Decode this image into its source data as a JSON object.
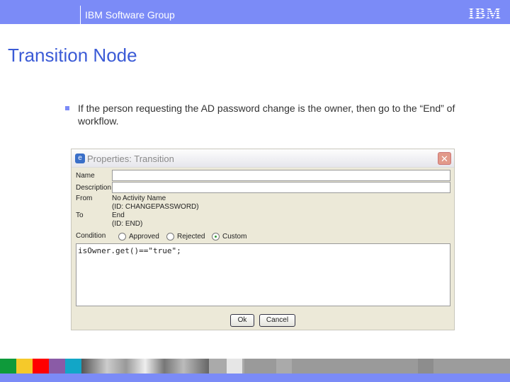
{
  "header": {
    "group": "IBM Software Group",
    "logo": "IBM"
  },
  "slide": {
    "title": "Transition Node",
    "bullet": "If the person requesting the AD password change is the owner, then go to the “End” of workflow."
  },
  "dialog": {
    "title": "Properties: Transition",
    "close": "✕",
    "name_label": "Name",
    "name_value": "",
    "description_label": "Description",
    "description_value": "",
    "from_label": "From",
    "from_line1": "No Activity Name",
    "from_line2": "(ID: CHANGEPASSWORD)",
    "to_label": "To",
    "to_line1": "End",
    "to_line2": "(ID: END)",
    "condition_label": "Condition",
    "options": [
      "Approved",
      "Rejected",
      "Custom"
    ],
    "selected": "Custom",
    "condition_text": "isOwner.get()==\"true\";",
    "ok": "Ok",
    "cancel": "Cancel"
  },
  "colors": {
    "header": "#7b8bf7",
    "title": "#3b5bd6"
  }
}
